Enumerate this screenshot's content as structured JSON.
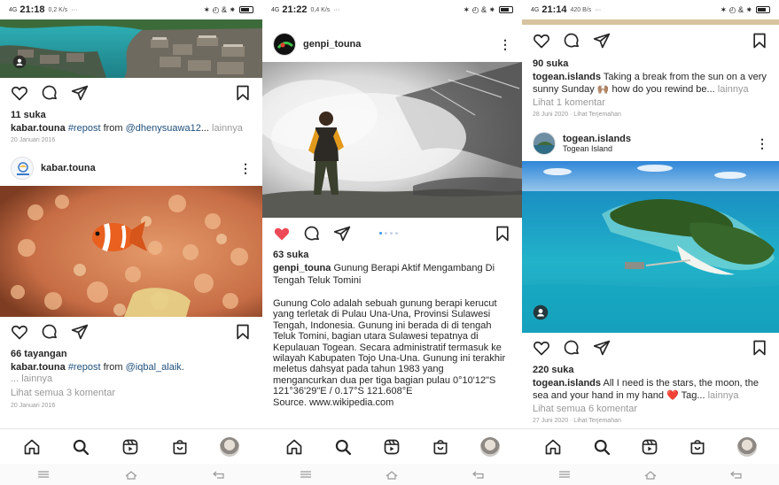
{
  "status_bars": [
    {
      "time": "21:18",
      "signal": "4G",
      "net": "0,2 K/s",
      "extra": "···",
      "icons": "✶ ◴ & ⁕"
    },
    {
      "time": "21:22",
      "signal": "4G",
      "net": "0,4 K/s",
      "extra": "···",
      "icons": "✶ ◴ & ⁕"
    },
    {
      "time": "21:14",
      "signal": "4G",
      "net": "420 B/s",
      "extra": "···",
      "icons": "✶ ◴ & ⁕"
    }
  ],
  "screen1": {
    "post1": {
      "likes": "11 suka",
      "user": "kabar.touna",
      "tag": "#repost",
      "text_from": " from ",
      "mention": "@dhenysuawa12",
      "ellipsis": "...",
      "more": " lainnya",
      "date": "20 Januari 2016"
    },
    "post2_header": {
      "user": "kabar.touna"
    },
    "post2": {
      "likes": "66 tayangan",
      "user": "kabar.touna",
      "tag": "#repost",
      "text_from": " from ",
      "mention": "@iqbal_alaik.",
      "more_line": "... lainnya",
      "comments": "Lihat semua 3 komentar",
      "date": "20 Januari 2016"
    }
  },
  "screen2": {
    "header": {
      "user": "genpi_touna"
    },
    "post": {
      "likes": "63 suka",
      "user": "genpi_touna",
      "title": " Gunung Berapi Aktif Mengambang Di Tengah Teluk Tomini",
      "body": [
        "Gunung Colo adalah sebuah gunung berapi kerucut",
        "yang terletak di Pulau Una-Una, Provinsi Sulawesi",
        "Tengah, Indonesia. Gunung ini berada di di tengah",
        "Teluk Tomini, bagian utara Sulawesi tepatnya di",
        "Kepulauan Togean. Secara administratif termasuk ke",
        "wilayah Kabupaten Tojo Una-Una. Gunung ini terakhir",
        "meletus dahsyat pada tahun 1983 yang",
        "mengancurkan dua per tiga bagian pulau  0°10'12\"S",
        "121°36'29\"E / 0.17°S 121.608°E",
        "Source. www.wikipedia.com"
      ]
    }
  },
  "screen3": {
    "post1": {
      "likes": "90 suka",
      "user": "togean.islands",
      "text": " Taking a break from the sun on a very sunny Sunday 🙌🏽 how do you rewind be...",
      "more": " lainnya",
      "comments": "Lihat 1 komentar",
      "date": "28 Juni 2020 · Lihat Terjemahan"
    },
    "post2_header": {
      "user": "togean.islands",
      "location": "Togean Island"
    },
    "post2": {
      "likes": "220 suka",
      "user": "togean.islands",
      "text": " All I need is the stars, the moon, the sea and your hand in my hand ❤️ Tag...",
      "more": " lainnya",
      "comments": "Lihat semua 6 komentar",
      "date": "27 Juni 2020 · Lihat Terjemahan"
    }
  },
  "colors": {
    "like_red": "#ed4956",
    "link_blue": "#1e4f7d",
    "muted": "#999999",
    "dot_active": "#3897f0"
  },
  "icons": [
    "home-icon",
    "search-icon",
    "reels-icon",
    "shop-icon",
    "profile-avatar",
    "heart-icon",
    "comment-icon",
    "share-icon",
    "save-icon",
    "more-icon"
  ]
}
